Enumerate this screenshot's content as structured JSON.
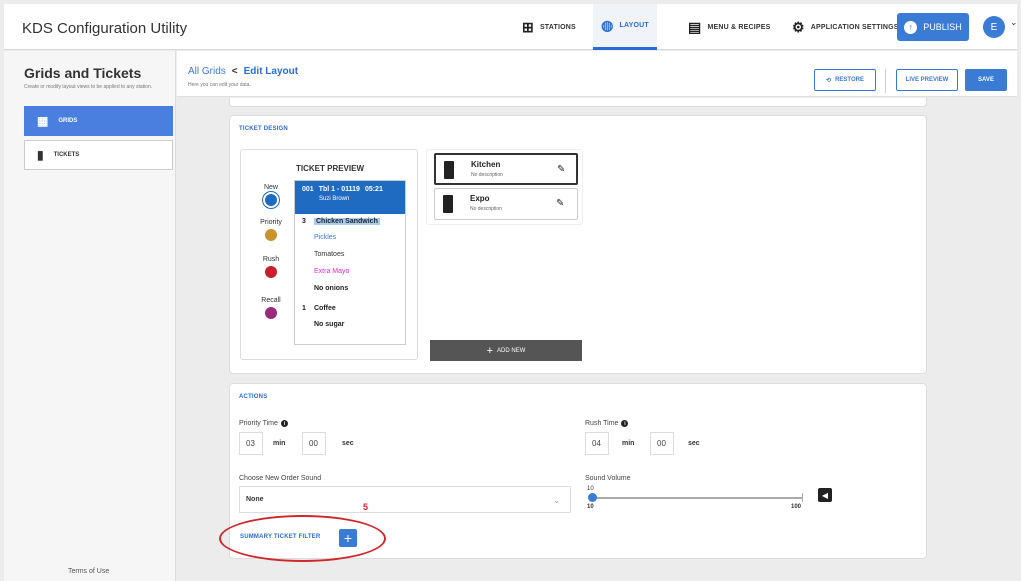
{
  "app": {
    "title": "KDS Configuration Utility"
  },
  "topnav": {
    "items": [
      {
        "label": "STATIONS",
        "icon": "stations-icon"
      },
      {
        "label": "LAYOUT",
        "icon": "palette-icon"
      },
      {
        "label": "MENU & RECIPES",
        "icon": "book-icon"
      },
      {
        "label": "APPLICATION SETTINGS",
        "icon": "gear-icon"
      }
    ],
    "active": "LAYOUT",
    "publish": "PUBLISH",
    "avatar": "E"
  },
  "sidebar": {
    "title": "Grids and Tickets",
    "subtitle": "Create or modify layout views to be applied to any station.",
    "items": [
      {
        "label": "GRIDS",
        "active": true
      },
      {
        "label": "TICKETS",
        "active": false
      }
    ],
    "terms": "Terms of Use"
  },
  "header": {
    "breadcrumb_parent": "All Grids",
    "breadcrumb_sep": "<",
    "breadcrumb_current": "Edit Layout",
    "subtitle": "Here you can edit your data.",
    "restore": "RESTORE",
    "live_preview": "LIVE PREVIEW",
    "save": "SAVE"
  },
  "ticket_design": {
    "heading": "TICKET DESIGN",
    "legend": [
      {
        "label": "New",
        "color": "#1f6bc2"
      },
      {
        "label": "Priority",
        "color": "#c8922e"
      },
      {
        "label": "Rush",
        "color": "#c8202a"
      },
      {
        "label": "Recall",
        "color": "#9b2a7a"
      }
    ],
    "preview_title": "TICKET PREVIEW",
    "ticket": {
      "number": "001",
      "table": "Tbl 1 - 01119",
      "time": "05:21",
      "server": "Suzi Brown",
      "lines": [
        {
          "qty": "3",
          "text": "Chicken Sandwich",
          "style": "highlight"
        },
        {
          "qty": "",
          "text": "Pickles",
          "style": "blue"
        },
        {
          "qty": "",
          "text": "Tomatoes",
          "style": "normal"
        },
        {
          "qty": "",
          "text": "Extra Mayo",
          "style": "magenta"
        },
        {
          "qty": "",
          "text": "No onions",
          "style": "bold"
        },
        {
          "qty": "1",
          "text": "Coffee",
          "style": "bold"
        },
        {
          "qty": "",
          "text": "No sugar",
          "style": "bold"
        }
      ]
    },
    "stations": [
      {
        "name": "Kitchen",
        "desc": "No description",
        "selected": true
      },
      {
        "name": "Expo",
        "desc": "No description",
        "selected": false
      }
    ],
    "add_new": "ADD NEW"
  },
  "actions": {
    "heading": "ACTIONS",
    "priority_label": "Priority Time",
    "priority_min": "03",
    "priority_sec": "00",
    "rush_label": "Rush Time",
    "rush_min": "04",
    "rush_sec": "00",
    "min_unit": "min",
    "sec_unit": "sec",
    "sound_label": "Choose New Order Sound",
    "sound_value": "None",
    "volume_label": "Sound Volume",
    "volume_value": "10",
    "volume_min": "10",
    "volume_max": "100",
    "summary_label": "SUMMARY TICKET FILTER",
    "annotation_number": "5"
  }
}
